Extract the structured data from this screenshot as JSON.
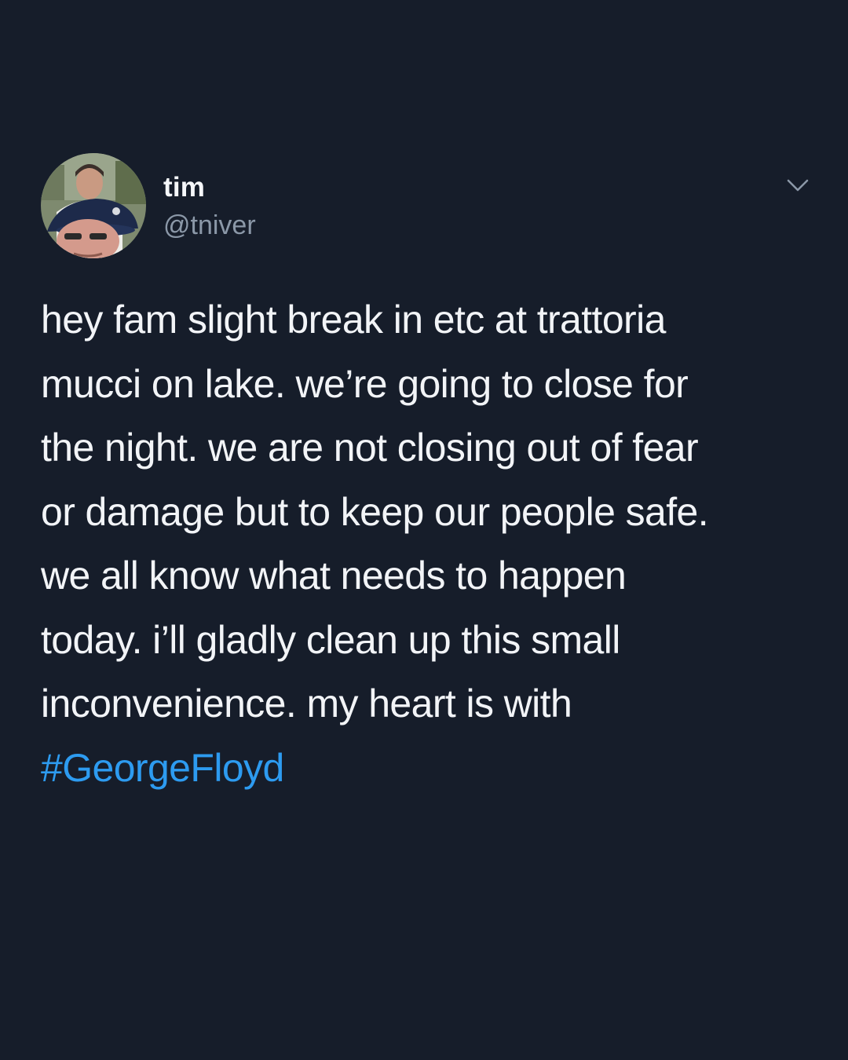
{
  "tweet": {
    "author": {
      "display_name": "tim",
      "handle": "@tniver",
      "avatar": "profile-photo"
    },
    "menu_icon": "chevron-down-icon",
    "body_lines": [
      "hey fam slight break in etc at trattoria",
      "mucci on lake. we’re going to close for",
      "the night. we are not closing out of fear",
      "or damage but to keep our people safe.",
      "we all know what needs to happen",
      "today. i’ll gladly clean up this small",
      "inconvenience. my heart is with"
    ],
    "hashtag": "#GeorgeFloyd"
  },
  "colors": {
    "background": "#161d2a",
    "text": "#f2f4f7",
    "handle": "#8b98a8",
    "hashtag": "#2d9bf0"
  }
}
